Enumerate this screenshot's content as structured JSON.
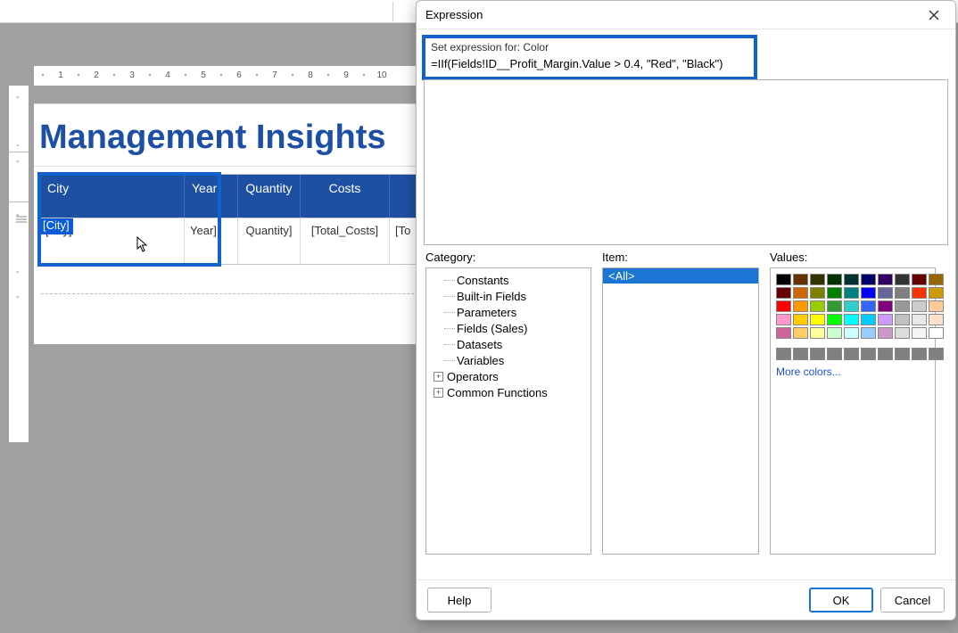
{
  "top_cells": [
    440,
    600
  ],
  "ruler": {
    "numbers": [
      1,
      2,
      3,
      4,
      5,
      6,
      7,
      8,
      9,
      10
    ],
    "step": 40,
    "start": 30
  },
  "ruler_v": {
    "minuses": [
      8,
      62,
      80,
      140,
      204,
      232
    ],
    "seg": [
      74,
      130
    ]
  },
  "report": {
    "title": "Management Insights",
    "columns": [
      {
        "header": "City",
        "field": "[City]",
        "cls": "c-city"
      },
      {
        "header": "Year",
        "field": "Year]",
        "cls": "c-year"
      },
      {
        "header": "Quantity",
        "field": "Quantity]",
        "cls": "c-qty"
      },
      {
        "header": "Costs",
        "field": "[Total_Costs]",
        "cls": "c-cost"
      },
      {
        "header": "",
        "field": "[To",
        "cls": "c-rev"
      }
    ],
    "selected_cell_text": "[City]"
  },
  "dialog": {
    "title": "Expression",
    "set_label": "Set expression for: Color",
    "expression": "=IIf(Fields!ID__Profit_Margin.Value > 0.4, \"Red\", \"Black\")",
    "category_label": "Category:",
    "item_label": "Item:",
    "values_label": "Values:",
    "categories": [
      "Constants",
      "Built-in Fields",
      "Parameters",
      "Fields (Sales)",
      "Datasets",
      "Variables",
      "Operators",
      "Common Functions"
    ],
    "category_expand": {
      "Operators": "+",
      "Common Functions": "+"
    },
    "item_selected": "<All>",
    "colors_row1": [
      "#000000",
      "#663300",
      "#333300",
      "#003300",
      "#003333",
      "#000066",
      "#330066",
      "#333333",
      "#660000",
      "#996600"
    ],
    "colors_row2": [
      "#660000",
      "#cc6600",
      "#808000",
      "#008000",
      "#008080",
      "#0000ff",
      "#666699",
      "#808080",
      "#ff3300",
      "#cc9900"
    ],
    "colors_row3": [
      "#ff0000",
      "#ff9900",
      "#99cc00",
      "#339933",
      "#33cccc",
      "#3366ff",
      "#800080",
      "#999999",
      "#cccccc",
      "#ffcc99"
    ],
    "colors_row4": [
      "#ff99cc",
      "#ffcc00",
      "#ffff00",
      "#00ff00",
      "#00ffff",
      "#00ccff",
      "#cc99ff",
      "#c0c0c0",
      "#e8e8e8",
      "#ffe0cc"
    ],
    "colors_row5": [
      "#cc6699",
      "#ffcc66",
      "#ffff99",
      "#ccffcc",
      "#ccffff",
      "#99ccff",
      "#cc99cc",
      "#dcdcdc",
      "#f5f5f5",
      "#ffffff"
    ],
    "colors_row6": [
      "#808080",
      "#808080",
      "#808080",
      "#808080",
      "#808080",
      "#808080",
      "#808080",
      "#808080",
      "#808080",
      "#808080"
    ],
    "more_colors": "More colors...",
    "help": "Help",
    "ok": "OK",
    "cancel": "Cancel"
  }
}
